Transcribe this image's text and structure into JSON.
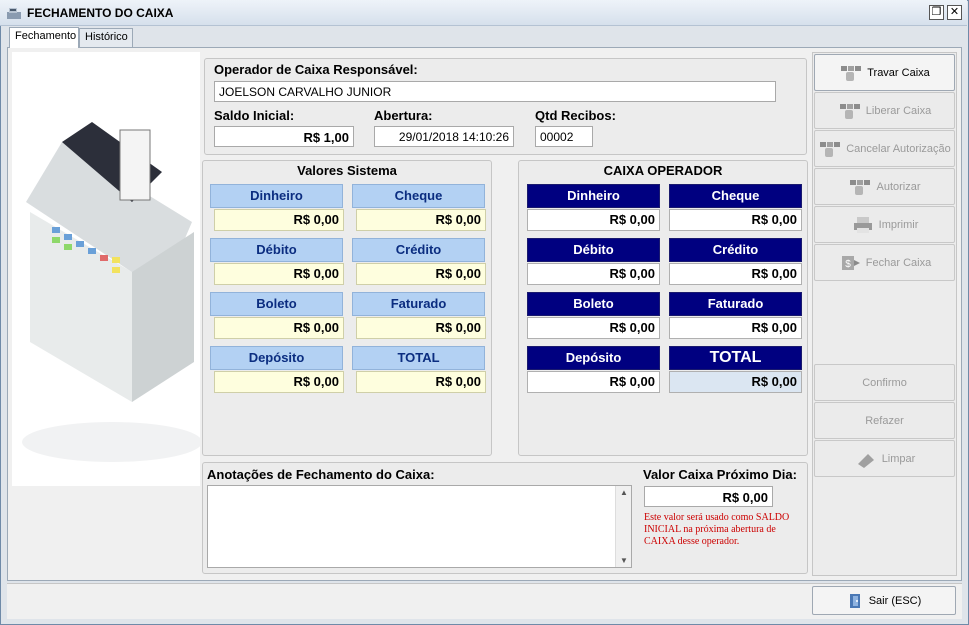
{
  "window": {
    "title": "FECHAMENTO DO CAIXA",
    "restore_glyph": "❐",
    "close_glyph": "✕"
  },
  "tabs": [
    {
      "label": "Fechamento"
    },
    {
      "label": "Histórico"
    }
  ],
  "operator": {
    "label": "Operador de Caixa Responsável:",
    "value": "JOELSON CARVALHO JUNIOR",
    "saldo_label": "Saldo Inicial:",
    "saldo_value": "R$ 1,00",
    "abertura_label": "Abertura:",
    "abertura_value": "29/01/2018 14:10:26",
    "recibos_label": "Qtd Recibos:",
    "recibos_value": "00002"
  },
  "sistema": {
    "title": "Valores Sistema",
    "cells": [
      {
        "label": "Dinheiro",
        "value": "R$ 0,00"
      },
      {
        "label": "Cheque",
        "value": "R$ 0,00"
      },
      {
        "label": "Débito",
        "value": "R$ 0,00"
      },
      {
        "label": "Crédito",
        "value": "R$ 0,00"
      },
      {
        "label": "Boleto",
        "value": "R$ 0,00"
      },
      {
        "label": "Faturado",
        "value": "R$ 0,00"
      },
      {
        "label": "Depósito",
        "value": "R$ 0,00"
      },
      {
        "label": "TOTAL",
        "value": "R$ 0,00"
      }
    ]
  },
  "operador": {
    "title": "CAIXA OPERADOR",
    "cells": [
      {
        "label": "Dinheiro",
        "value": "R$ 0,00"
      },
      {
        "label": "Cheque",
        "value": "R$ 0,00"
      },
      {
        "label": "Débito",
        "value": "R$ 0,00"
      },
      {
        "label": "Crédito",
        "value": "R$ 0,00"
      },
      {
        "label": "Boleto",
        "value": "R$ 0,00"
      },
      {
        "label": "Faturado",
        "value": "R$ 0,00"
      },
      {
        "label": "Depósito",
        "value": "R$ 0,00"
      },
      {
        "label": "TOTAL",
        "value": "R$ 0,00"
      }
    ]
  },
  "notes": {
    "label": "Anotações de Fechamento do Caixa:",
    "value": ""
  },
  "next_day": {
    "label": "Valor Caixa Próximo Dia:",
    "value": "R$ 0,00",
    "hint": "Este valor será usado como SALDO INICIAL na próxima abertura de CAIXA desse operador."
  },
  "side_buttons": [
    {
      "label": "Travar Caixa",
      "icon": "hand-cards-icon",
      "enabled": true
    },
    {
      "label": "Liberar Caixa",
      "icon": "hand-cards-icon",
      "enabled": false
    },
    {
      "label": "Cancelar Autorização",
      "icon": "hand-cards-icon",
      "enabled": false
    },
    {
      "label": "Autorizar",
      "icon": "hand-cards-icon",
      "enabled": false
    },
    {
      "label": "Imprimir",
      "icon": "printer-icon",
      "enabled": false
    },
    {
      "label": "Fechar Caixa",
      "icon": "money-icon",
      "enabled": false
    },
    {
      "label": "Confirmo",
      "icon": "",
      "enabled": false
    },
    {
      "label": "Refazer",
      "icon": "",
      "enabled": false
    },
    {
      "label": "Limpar",
      "icon": "eraser-icon",
      "enabled": false
    }
  ],
  "exit_button": {
    "label": "Sair (ESC)",
    "icon": "exit-door-icon"
  },
  "colors": {
    "dark_header": "#000080",
    "light_header": "#b3d1f3",
    "hint_red": "#cc0000"
  }
}
